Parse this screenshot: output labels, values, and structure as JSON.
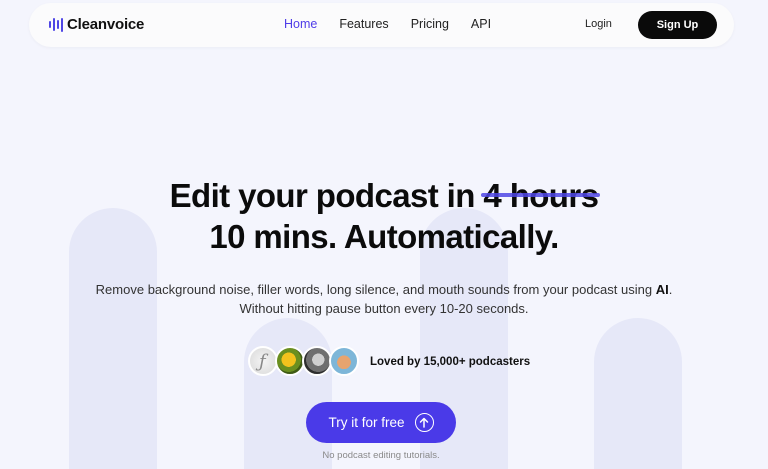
{
  "nav": {
    "brand": "Cleanvoice",
    "links": [
      "Home",
      "Features",
      "Pricing",
      "API"
    ],
    "active_index": 0,
    "login": "Login",
    "signup": "Sign Up"
  },
  "hero": {
    "headline_prefix": "Edit your podcast in ",
    "headline_struck": "4 hours",
    "headline_line2": "10 mins. Automatically.",
    "subtitle_line1_pre": "Remove background noise, filler words, long silence, and mouth sounds from your podcast using ",
    "subtitle_line1_bold": "AI",
    "subtitle_line1_post": ".",
    "subtitle_line2": "Without hitting pause button every 10-20 seconds.",
    "social_proof": "Loved by 15,000+ podcasters",
    "cta_label": "Try it for free",
    "cta_note": "No podcast editing tutorials."
  },
  "colors": {
    "accent": "#4a3ae8",
    "background": "#f4f5fd",
    "signup_bg": "#0a0a0a"
  },
  "icons": {
    "logo": "soundwave-icon",
    "cta": "arrow-up-circle-icon"
  }
}
